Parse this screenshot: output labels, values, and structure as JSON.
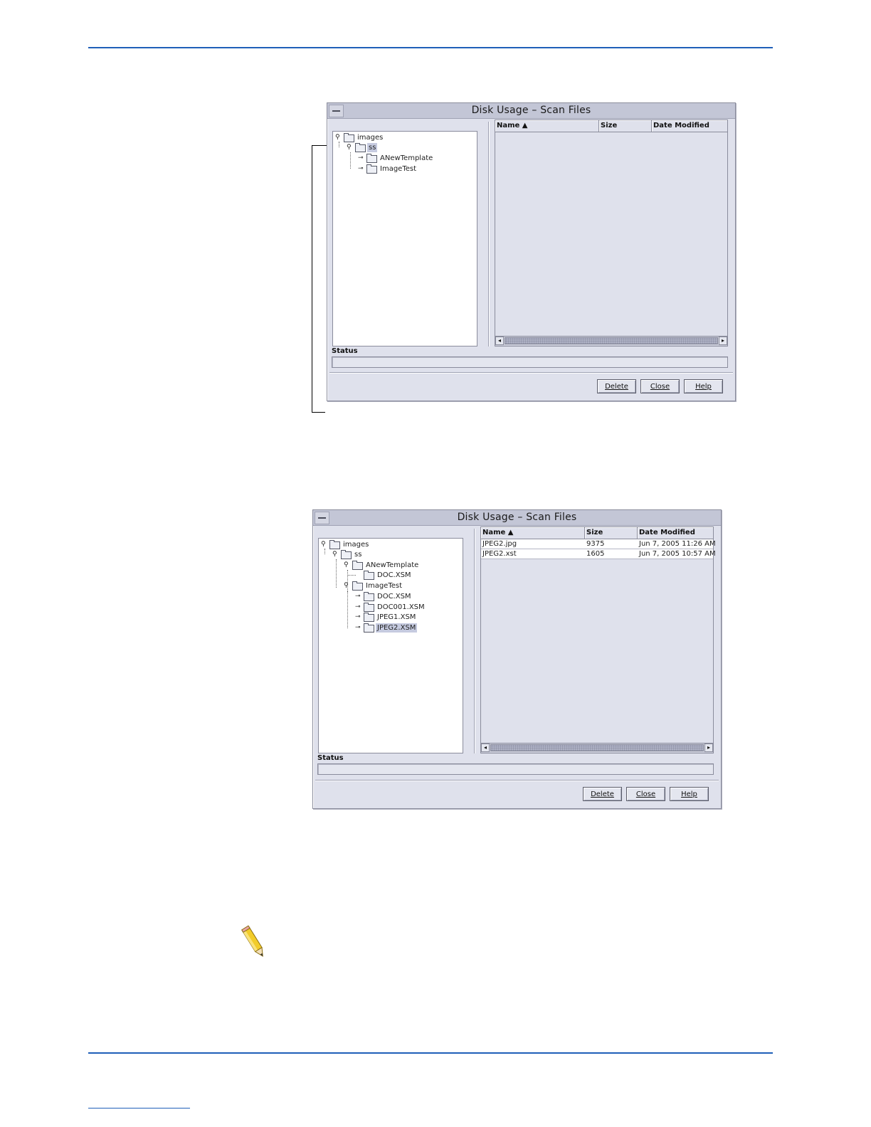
{
  "window1": {
    "title": "Disk Usage – Scan Files",
    "tree": [
      {
        "label": "images",
        "handle": "⚲"
      },
      {
        "label": "ss",
        "handle": "⚲",
        "selected": true
      },
      {
        "label": "ANewTemplate",
        "handle": "⊸"
      },
      {
        "label": "ImageTest",
        "handle": "⊸"
      }
    ],
    "table": {
      "columns": [
        "Name ▲",
        "Size",
        "Date Modified"
      ],
      "rows": []
    },
    "status_label": "Status",
    "buttons": {
      "delete": "Delete",
      "close": "Close",
      "help": "Help"
    }
  },
  "window2": {
    "title": "Disk Usage – Scan Files",
    "tree": [
      {
        "label": "images",
        "handle": "⚲"
      },
      {
        "label": "ss",
        "handle": "⚲"
      },
      {
        "label": "ANewTemplate",
        "handle": "⚲"
      },
      {
        "label": "DOC.XSM",
        "handle": ""
      },
      {
        "label": "ImageTest",
        "handle": "⚲"
      },
      {
        "label": "DOC.XSM",
        "handle": "⊸"
      },
      {
        "label": "DOC001.XSM",
        "handle": "⊸"
      },
      {
        "label": "JPEG1.XSM",
        "handle": "⊸"
      },
      {
        "label": "JPEG2.XSM",
        "handle": "⊸",
        "selected": true
      }
    ],
    "table": {
      "columns": [
        "Name ▲",
        "Size",
        "Date Modified"
      ],
      "rows": [
        {
          "name": "JPEG2.jpg",
          "size": "9375",
          "date": "Jun 7, 2005 11:26 AM"
        },
        {
          "name": "JPEG2.xst",
          "size": "1605",
          "date": "Jun 7, 2005 10:57 AM"
        }
      ]
    },
    "status_label": "Status",
    "buttons": {
      "delete": "Delete",
      "close": "Close",
      "help": "Help"
    }
  }
}
